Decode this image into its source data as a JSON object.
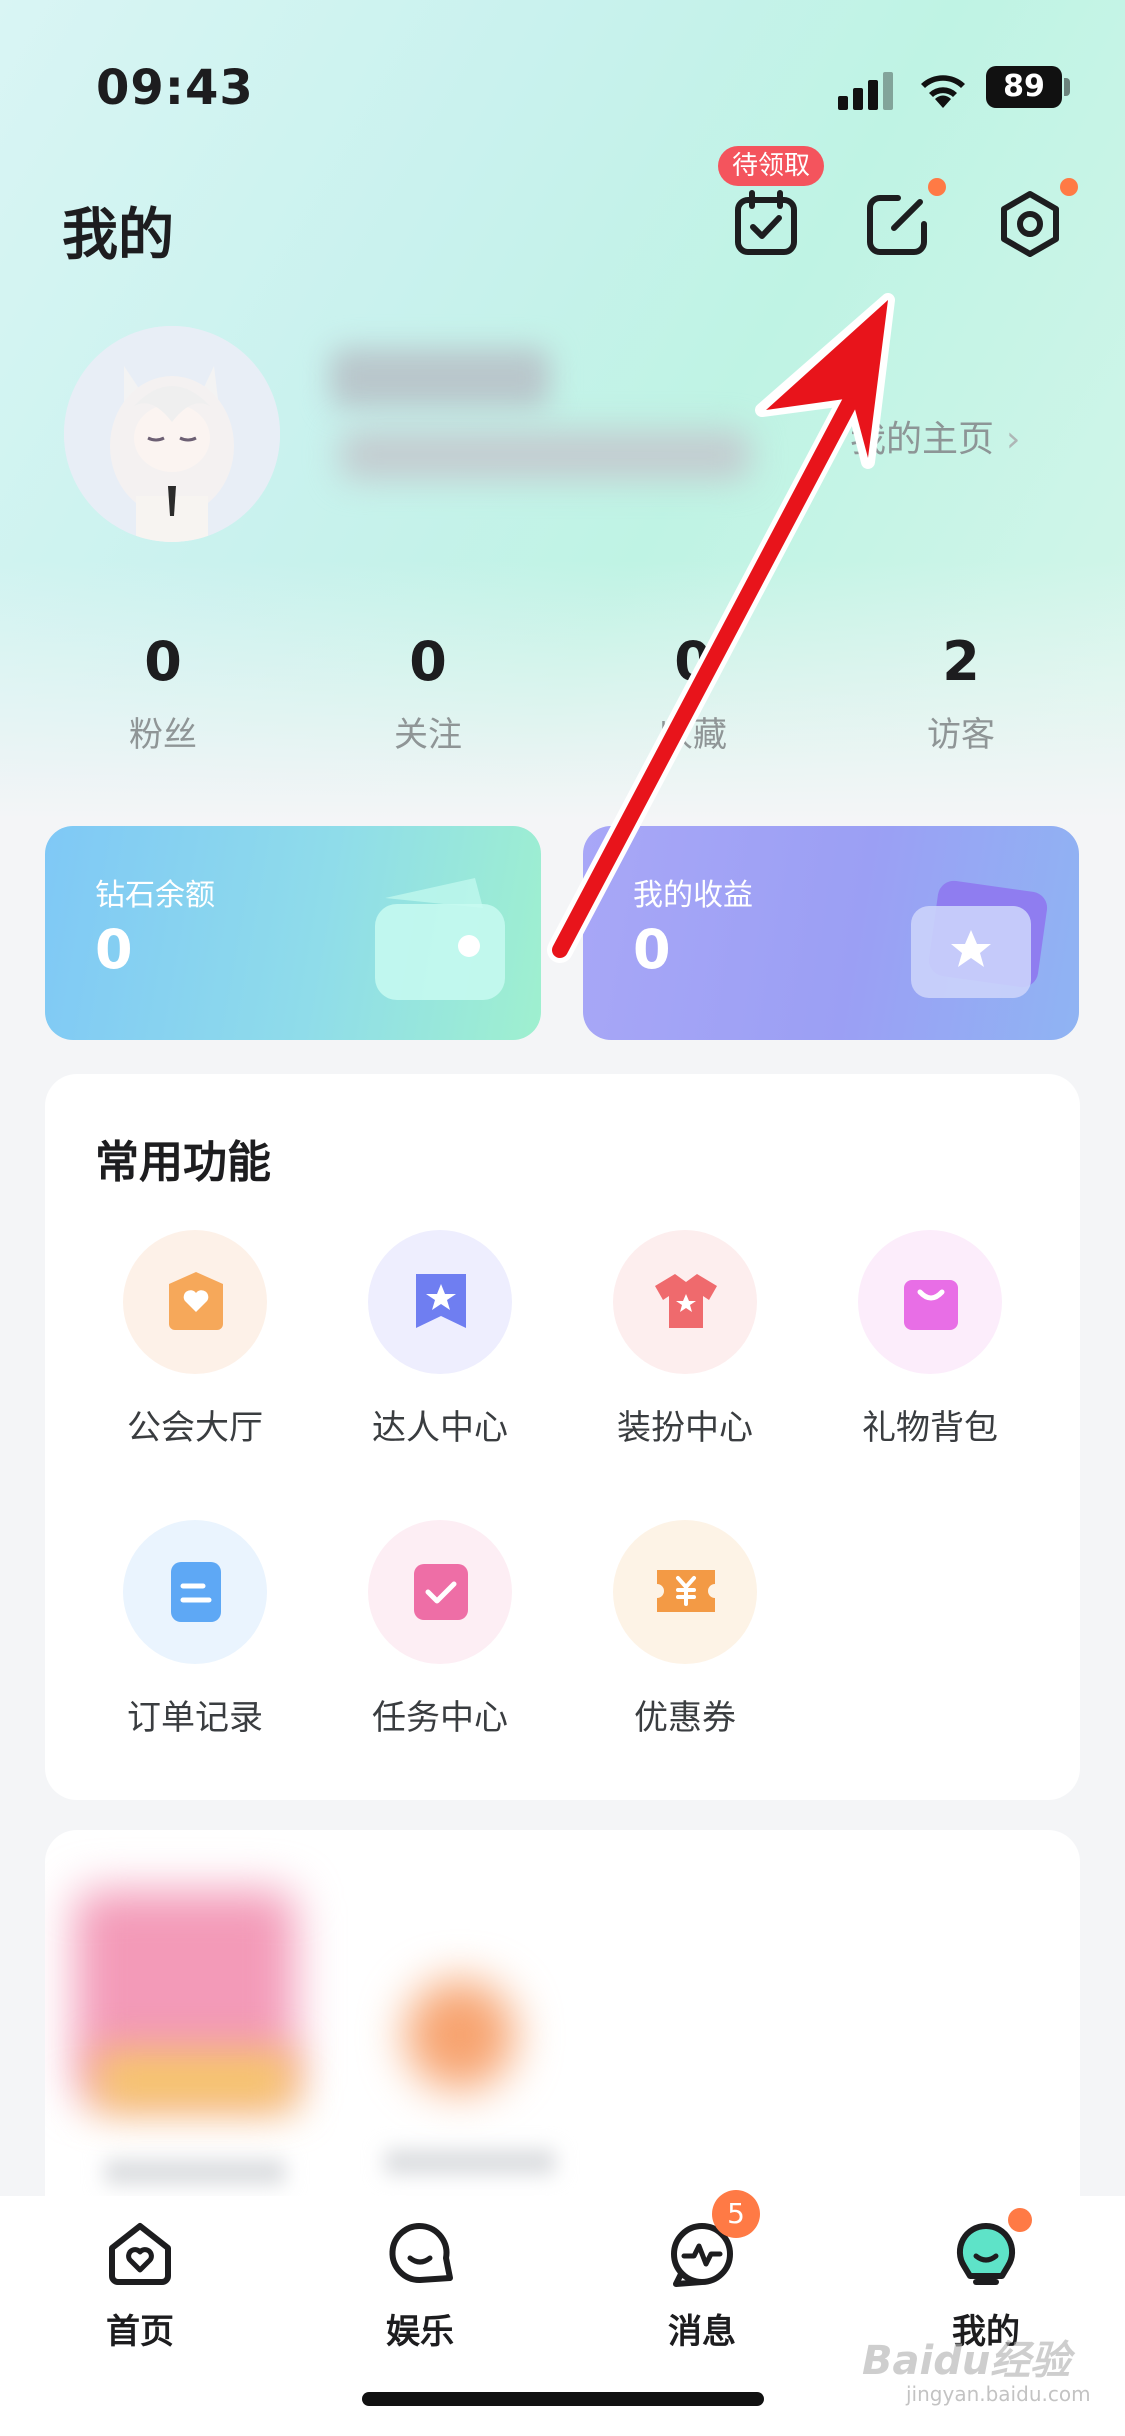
{
  "status_bar": {
    "time": "09:43",
    "battery": "89"
  },
  "header": {
    "title": "我的",
    "checkin_badge": "待领取"
  },
  "profile": {
    "homepage_label": "我的主页",
    "homepage_chevron": "›"
  },
  "stats": [
    {
      "value": "0",
      "label": "粉丝"
    },
    {
      "value": "0",
      "label": "关注"
    },
    {
      "value": "0",
      "label": "收藏"
    },
    {
      "value": "2",
      "label": "访客"
    }
  ],
  "cards": {
    "diamond": {
      "title": "钻石余额",
      "value": "0"
    },
    "earnings": {
      "title": "我的收益",
      "value": "0"
    }
  },
  "functions": {
    "title": "常用功能",
    "items": [
      {
        "label": "公会大厅",
        "icon": "guild-hall-icon"
      },
      {
        "label": "达人中心",
        "icon": "talent-center-icon"
      },
      {
        "label": "装扮中心",
        "icon": "dress-up-icon"
      },
      {
        "label": "礼物背包",
        "icon": "gift-bag-icon"
      },
      {
        "label": "订单记录",
        "icon": "order-record-icon"
      },
      {
        "label": "任务中心",
        "icon": "task-center-icon"
      },
      {
        "label": "优惠券",
        "icon": "coupon-icon"
      }
    ]
  },
  "tabbar": {
    "items": [
      {
        "label": "首页",
        "icon": "home-icon"
      },
      {
        "label": "娱乐",
        "icon": "entertainment-icon"
      },
      {
        "label": "消息",
        "icon": "message-icon",
        "badge": "5"
      },
      {
        "label": "我的",
        "icon": "me-icon"
      }
    ]
  },
  "watermark": {
    "brand": "Baidu经验",
    "url": "jingyan.baidu.com"
  },
  "colors": {
    "accent_red": "#f4545d",
    "dot_orange": "#ff7a45",
    "annotation_arrow": "#e8141b"
  }
}
